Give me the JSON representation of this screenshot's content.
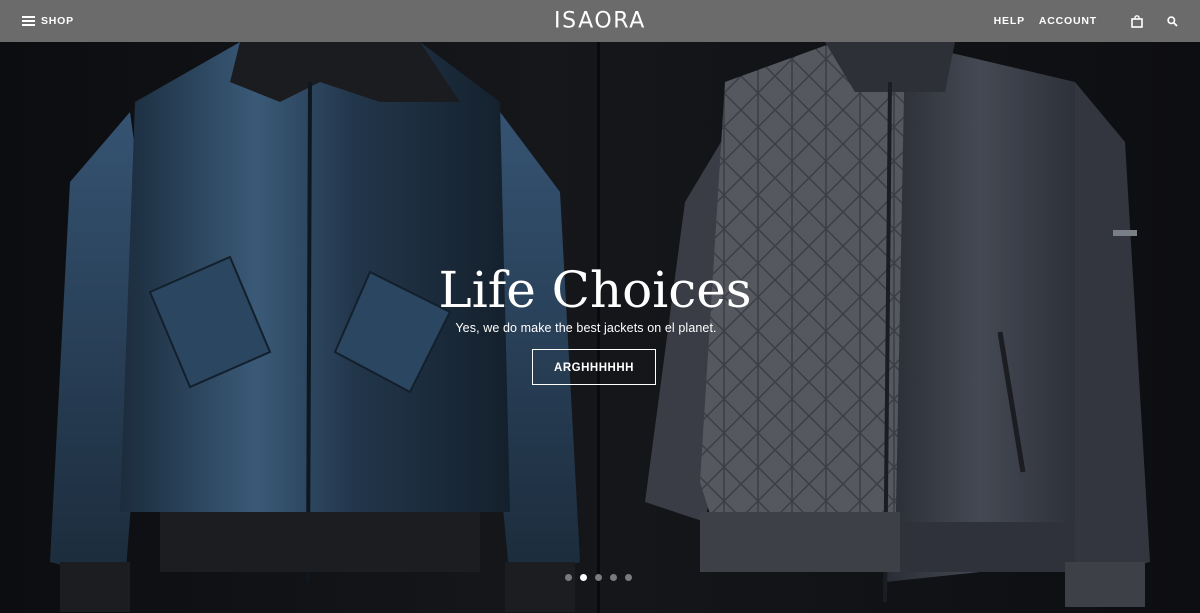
{
  "header": {
    "menu_label": "SHOP",
    "logo": "ISAORA",
    "help_label": "HELP",
    "account_label": "ACCOUNT",
    "icons": [
      "hamburger-icon",
      "bag-icon",
      "search-icon"
    ]
  },
  "hero": {
    "title": "Life Choices",
    "subtitle": "Yes, we do make the best jackets on el planet.",
    "cta_label": "ARGHHHHHH",
    "slides": {
      "count": 5,
      "active_index": 2
    }
  },
  "colors": {
    "header_bg": "#6b6b6b",
    "text": "#ffffff",
    "left_jacket": "#24384c",
    "right_jacket": "#3a3d46"
  }
}
